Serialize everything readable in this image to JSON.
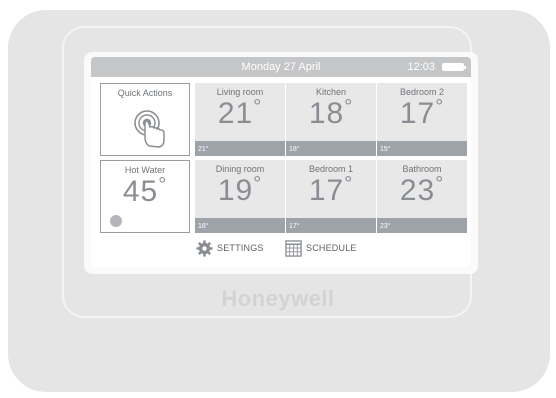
{
  "header": {
    "date": "Monday 27 April",
    "time": "12:03",
    "battery_icon": "battery-icon"
  },
  "quick_actions": {
    "label": "Quick Actions",
    "icon": "touch-hand-icon"
  },
  "hot_water": {
    "label": "Hot Water",
    "temp": "45",
    "degree": "°",
    "status_icon": "indicator-dot-icon"
  },
  "zones": [
    {
      "name": "Living room",
      "temp": "21",
      "degree": "°",
      "setpoint": "21°"
    },
    {
      "name": "Kitchen",
      "temp": "18",
      "degree": "°",
      "setpoint": "18°"
    },
    {
      "name": "Bedroom 2",
      "temp": "17",
      "degree": "°",
      "setpoint": "15°"
    },
    {
      "name": "Dining room",
      "temp": "19",
      "degree": "°",
      "setpoint": "18°"
    },
    {
      "name": "Bedroom 1",
      "temp": "17",
      "degree": "°",
      "setpoint": "17°"
    },
    {
      "name": "Bathroom",
      "temp": "23",
      "degree": "°",
      "setpoint": "23°"
    }
  ],
  "footer": {
    "settings_label": "SETTINGS",
    "schedule_label": "SCHEDULE",
    "settings_icon": "gear-icon",
    "schedule_icon": "calendar-grid-icon"
  },
  "brand": "Honeywell",
  "colors": {
    "device": "#e5e5e6",
    "topbar": "#c5c6c8",
    "tile": "#e8e8e9",
    "setpoint_bar": "#9ea3a9",
    "temperature": "#8a8e93"
  }
}
